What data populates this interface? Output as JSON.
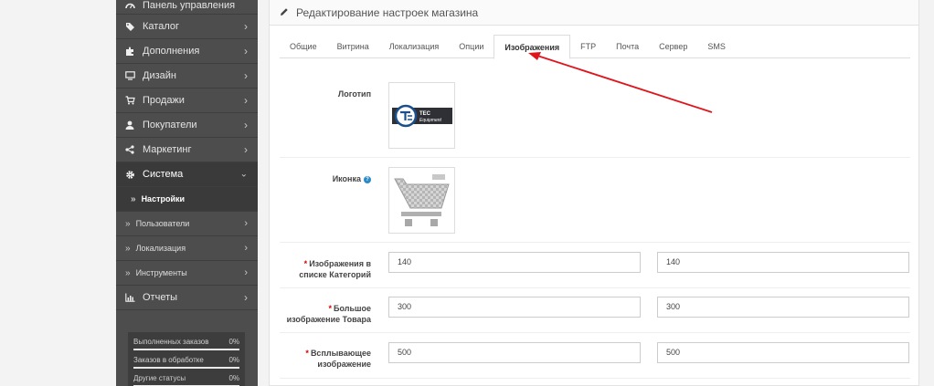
{
  "sidebar": {
    "items": [
      {
        "label": "Панель управления",
        "icon": "dashboard-icon"
      },
      {
        "label": "Каталог",
        "icon": "tags-icon"
      },
      {
        "label": "Дополнения",
        "icon": "puzzle-icon"
      },
      {
        "label": "Дизайн",
        "icon": "desktop-icon"
      },
      {
        "label": "Продажи",
        "icon": "cart-icon"
      },
      {
        "label": "Покупатели",
        "icon": "user-icon"
      },
      {
        "label": "Маркетинг",
        "icon": "share-icon"
      },
      {
        "label": "Система",
        "icon": "cog-icon"
      }
    ],
    "subitems": [
      "Настройки",
      "Пользователи",
      "Локализация",
      "Инструменты"
    ],
    "reports": {
      "label": "Отчеты",
      "icon": "bar-chart-icon"
    },
    "stats": [
      {
        "label": "Выполненных заказов",
        "value": "0%",
        "progress": 0
      },
      {
        "label": "Заказов в обработке",
        "value": "0%",
        "progress": 0
      },
      {
        "label": "Другие статусы",
        "value": "0%",
        "progress": 0
      }
    ]
  },
  "panel": {
    "title": "Редактирование настроек магазина",
    "tabs": [
      "Общие",
      "Витрина",
      "Локализация",
      "Опции",
      "Изображения",
      "FTP",
      "Почта",
      "Сервер",
      "SMS"
    ],
    "active_tab": "Изображения"
  },
  "form": {
    "logo_label": "Логотип",
    "icon_label": "Иконка",
    "logo_text_line1": "TEC",
    "logo_text_line2": "Equipment",
    "rows": [
      {
        "label": "Изображения в списке Категорий",
        "width": "140",
        "height": "140"
      },
      {
        "label": "Большое изображение Товара",
        "width": "300",
        "height": "300"
      },
      {
        "label": "Всплывающее изображение",
        "width": "500",
        "height": "500"
      }
    ],
    "required_mark": "*",
    "help_mark": "?"
  },
  "colors": {
    "sidebar_bg": "#4d4d4d",
    "sidebar_active": "#3a3a3a",
    "required": "#d90000",
    "annotation_arrow": "#e0141c",
    "help_icon": "#2a8ac8"
  }
}
